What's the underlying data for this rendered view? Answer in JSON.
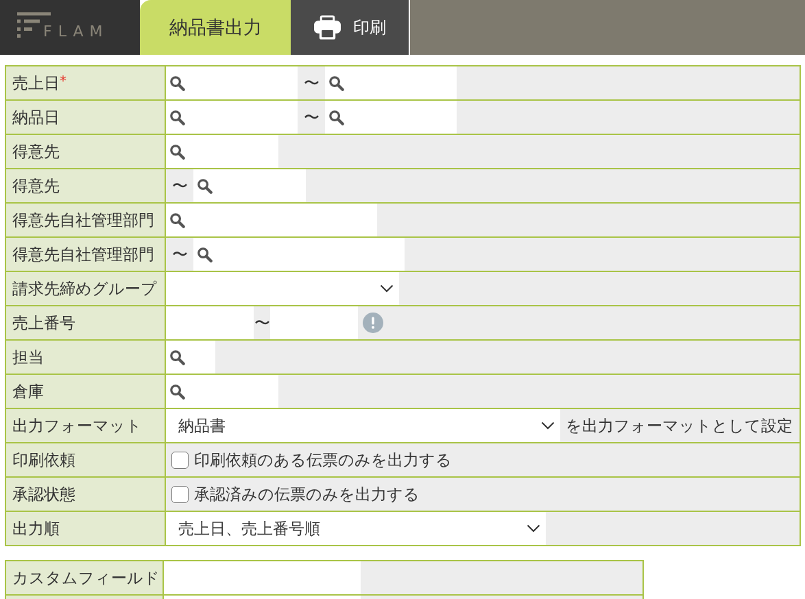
{
  "header": {
    "logo": "FLAM",
    "tabs": [
      {
        "label": "納品書出力",
        "selected": true
      }
    ],
    "print_button": {
      "label": "印刷"
    }
  },
  "fields": [
    {
      "label": "売上日",
      "required_mark": "*",
      "kind": "search_range",
      "separator": "〜"
    },
    {
      "label": "納品日",
      "kind": "search_range",
      "separator": "〜"
    },
    {
      "label": "得意先",
      "kind": "search"
    },
    {
      "label": "得意先",
      "kind": "search_to",
      "separator": "〜"
    },
    {
      "label": "得意先自社管理部門",
      "kind": "search"
    },
    {
      "label": "得意先自社管理部門",
      "kind": "search_to",
      "separator": "〜"
    },
    {
      "label": "請求先締めグループ",
      "kind": "select"
    },
    {
      "label": "売上番号",
      "kind": "text_range",
      "separator": "〜"
    },
    {
      "label": "担当",
      "kind": "search"
    },
    {
      "label": "倉庫",
      "kind": "search"
    },
    {
      "label": "出力フォーマット",
      "kind": "select",
      "value": "納品書",
      "note": "を出力フォーマットとして設定"
    },
    {
      "label": "印刷依頼",
      "kind": "checkbox",
      "checked": false,
      "text": "印刷依頼のある伝票のみを出力する"
    },
    {
      "label": "承認状態",
      "kind": "checkbox",
      "checked": false,
      "text": "承認済みの伝票のみを出力する"
    },
    {
      "label": "出力順",
      "kind": "select",
      "value": "売上日、売上番号順"
    }
  ],
  "custom_fields": [
    {
      "label": "カスタムフィールド"
    }
  ]
}
